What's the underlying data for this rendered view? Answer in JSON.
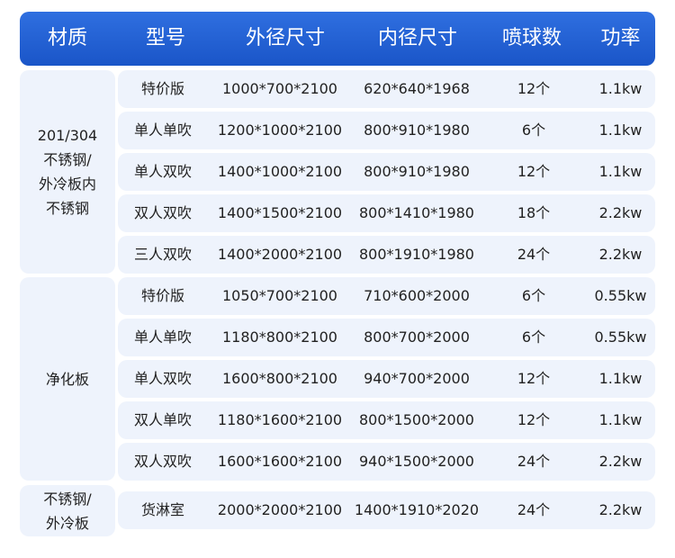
{
  "table": {
    "headers": [
      "材质",
      "型号",
      "外径尺寸",
      "内径尺寸",
      "喷球数",
      "功率"
    ],
    "groups": [
      {
        "material": "201/304\n不锈钢/\n外冷板内\n不锈钢",
        "rows": [
          [
            "特价版",
            "1000*700*2100",
            "620*640*1968",
            "12个",
            "1.1kw"
          ],
          [
            "单人单吹",
            "1200*1000*2100",
            "800*910*1980",
            "6个",
            "1.1kw"
          ],
          [
            "单人双吹",
            "1400*1000*2100",
            "800*910*1980",
            "12个",
            "1.1kw"
          ],
          [
            "双人双吹",
            "1400*1500*2100",
            "800*1410*1980",
            "18个",
            "2.2kw"
          ],
          [
            "三人双吹",
            "1400*2000*2100",
            "800*1910*1980",
            "24个",
            "2.2kw"
          ]
        ]
      },
      {
        "material": "净化板",
        "rows": [
          [
            "特价版",
            "1050*700*2100",
            "710*600*2000",
            "6个",
            "0.55kw"
          ],
          [
            "单人单吹",
            "1180*800*2100",
            "800*700*2000",
            "6个",
            "0.55kw"
          ],
          [
            "单人双吹",
            "1600*800*2100",
            "940*700*2000",
            "12个",
            "1.1kw"
          ],
          [
            "双人单吹",
            "1180*1600*2100",
            "800*1500*2000",
            "12个",
            "1.1kw"
          ],
          [
            "双人双吹",
            "1600*1600*2100",
            "940*1500*2000",
            "24个",
            "2.2kw"
          ]
        ]
      },
      {
        "material": "不锈钢/\n外冷板",
        "rows": [
          [
            "货淋室",
            "2000*2000*2100",
            "1400*1910*2020",
            "24个",
            "2.2kw"
          ]
        ]
      }
    ]
  }
}
